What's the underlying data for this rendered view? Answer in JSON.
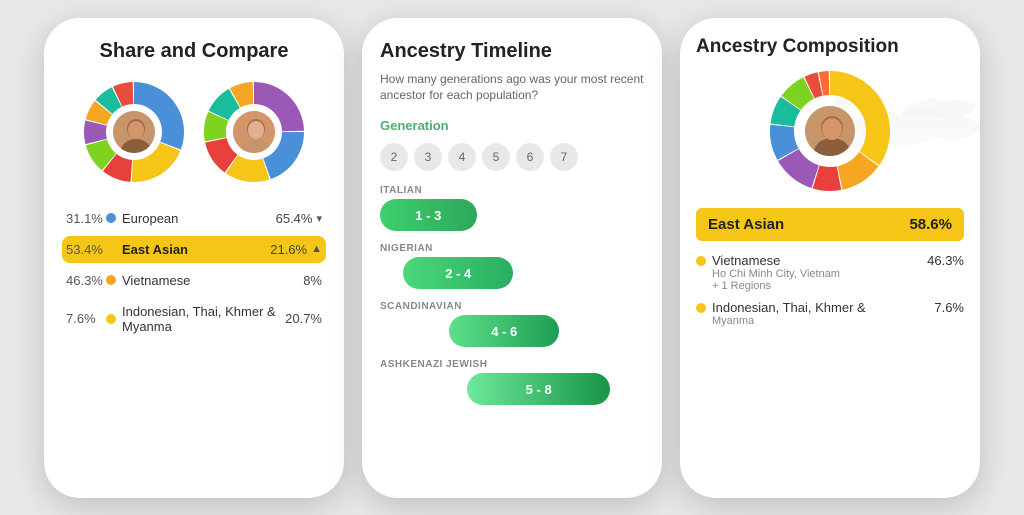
{
  "phone1": {
    "title": "Share and Compare",
    "stats": [
      {
        "pct_left": "31.1%",
        "dot_color": "#4a90d9",
        "label": "European",
        "pct_right": "65.4%",
        "chevron": "▾",
        "highlighted": false
      },
      {
        "pct_left": "53.4%",
        "dot_color": "#f5c518",
        "label": "East Asian",
        "pct_right": "21.6%",
        "chevron": "▲",
        "highlighted": true
      },
      {
        "pct_left": "46.3%",
        "dot_color": "#f5a623",
        "label": "Vietnamese",
        "pct_right": "8%",
        "chevron": "",
        "highlighted": false
      },
      {
        "pct_left": "7.6%",
        "dot_color": "#f5c518",
        "label": "Indonesian, Thai, Khmer & Myanma",
        "pct_right": "20.7%",
        "chevron": "",
        "highlighted": false
      }
    ],
    "donut1_segments": [
      {
        "color": "#4a90d9",
        "pct": 31.1
      },
      {
        "color": "#f5c518",
        "pct": 20
      },
      {
        "color": "#e8403c",
        "pct": 10
      },
      {
        "color": "#7ed321",
        "pct": 10
      },
      {
        "color": "#9b59b6",
        "pct": 8
      },
      {
        "color": "#f5a623",
        "pct": 7
      },
      {
        "color": "#1abc9c",
        "pct": 7
      },
      {
        "color": "#e74c3c",
        "pct": 6.9
      }
    ],
    "donut2_segments": [
      {
        "color": "#9b59b6",
        "pct": 25
      },
      {
        "color": "#4a90d9",
        "pct": 20
      },
      {
        "color": "#f5c518",
        "pct": 15
      },
      {
        "color": "#e8403c",
        "pct": 12
      },
      {
        "color": "#7ed321",
        "pct": 10
      },
      {
        "color": "#1abc9c",
        "pct": 10
      },
      {
        "color": "#f5a623",
        "pct": 8
      }
    ]
  },
  "phone2": {
    "title": "Ancestry Timeline",
    "subtitle": "How many generations ago was your most recent ancestor for each population?",
    "generation_label": "Generation",
    "gen_numbers": [
      "2",
      "3",
      "4",
      "5",
      "6",
      "7"
    ],
    "timeline_items": [
      {
        "population": "ITALIAN",
        "label": "1 - 3",
        "offset_pct": 0,
        "width_pct": 42,
        "color_start": "#3ecf6e",
        "color_end": "#2da85a"
      },
      {
        "population": "NIGERIAN",
        "label": "2 - 4",
        "offset_pct": 10,
        "width_pct": 48,
        "color_start": "#4cd87a",
        "color_end": "#27ae60"
      },
      {
        "population": "SCANDINAVIAN",
        "label": "4 - 6",
        "offset_pct": 30,
        "width_pct": 48,
        "color_start": "#5de08a",
        "color_end": "#1e9e52"
      },
      {
        "population": "ASHKENAZI JEWISH",
        "label": "5 - 8",
        "offset_pct": 38,
        "width_pct": 62,
        "color_start": "#6ee89a",
        "color_end": "#17934a"
      }
    ]
  },
  "phone3": {
    "title": "Ancestry Composition",
    "east_asian_label": "East Asian",
    "east_asian_pct": "58.6%",
    "details": [
      {
        "dot_color": "#f5c518",
        "name": "Vietnamese",
        "sub1": "Ho Chi Minh City, Vietnam",
        "sub2": "+ 1 Regions",
        "pct": "46.3%"
      },
      {
        "dot_color": "#f5c518",
        "name": "Indonesian, Thai, Khmer &",
        "sub1": "Myanma",
        "sub2": "",
        "pct": "7.6%"
      }
    ],
    "donut_segments": [
      {
        "color": "#f5c518",
        "pct": 35
      },
      {
        "color": "#f5a623",
        "pct": 12
      },
      {
        "color": "#e8403c",
        "pct": 8
      },
      {
        "color": "#9b59b6",
        "pct": 12
      },
      {
        "color": "#4a90d9",
        "pct": 10
      },
      {
        "color": "#1abc9c",
        "pct": 8
      },
      {
        "color": "#7ed321",
        "pct": 8
      },
      {
        "color": "#e74c3c",
        "pct": 4
      },
      {
        "color": "#ff6b35",
        "pct": 3
      }
    ]
  }
}
